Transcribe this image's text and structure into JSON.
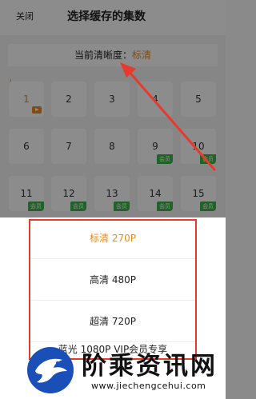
{
  "header": {
    "close_label": "关闭",
    "title": "选择缓存的集数"
  },
  "clarity": {
    "prefix": "当前清晰度：",
    "value": "标清"
  },
  "episodes": [
    {
      "num": "1",
      "active": true,
      "play": true,
      "vip": false
    },
    {
      "num": "2",
      "active": false,
      "play": false,
      "vip": false
    },
    {
      "num": "3",
      "active": false,
      "play": false,
      "vip": false
    },
    {
      "num": "4",
      "active": false,
      "play": false,
      "vip": false
    },
    {
      "num": "5",
      "active": false,
      "play": false,
      "vip": false
    },
    {
      "num": "6",
      "active": false,
      "play": false,
      "vip": false
    },
    {
      "num": "7",
      "active": false,
      "play": false,
      "vip": false
    },
    {
      "num": "8",
      "active": false,
      "play": false,
      "vip": false
    },
    {
      "num": "9",
      "active": false,
      "play": false,
      "vip": true
    },
    {
      "num": "10",
      "active": false,
      "play": false,
      "vip": true
    },
    {
      "num": "11",
      "active": false,
      "play": false,
      "vip": true
    },
    {
      "num": "12",
      "active": false,
      "play": false,
      "vip": true
    },
    {
      "num": "13",
      "active": false,
      "play": false,
      "vip": true
    },
    {
      "num": "14",
      "active": false,
      "play": false,
      "vip": true
    },
    {
      "num": "15",
      "active": false,
      "play": false,
      "vip": true
    }
  ],
  "vip_badge_label": "会员",
  "quality_options": [
    {
      "label": "标清 270P",
      "selected": true
    },
    {
      "label": "高清 480P",
      "selected": false
    },
    {
      "label": "超清 720P",
      "selected": false
    },
    {
      "label": "蓝光 1080P VIP会员专享",
      "selected": false
    }
  ],
  "watermark": {
    "title": "阶乘资讯网",
    "url": "www.jiechengcehui.com"
  },
  "colors": {
    "accent": "#f08a16",
    "vip_green": "#3bb34a",
    "annotation_red": "#e63a2c",
    "brand_blue": "#1a4fb8"
  }
}
